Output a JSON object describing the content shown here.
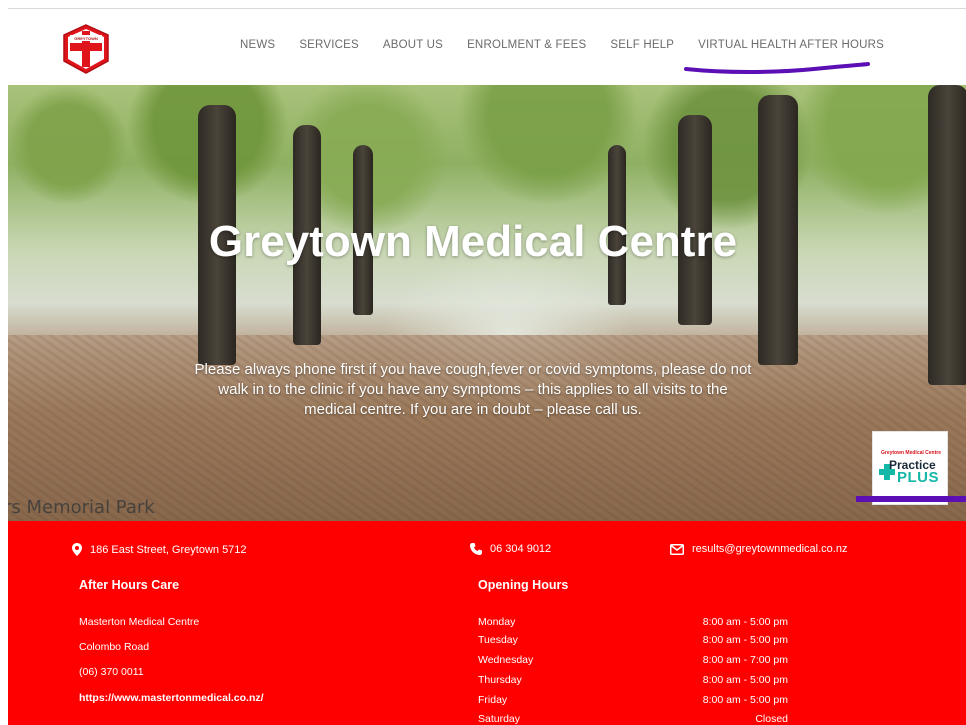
{
  "nav": {
    "items": [
      "NEWS",
      "SERVICES",
      "ABOUT US",
      "ENROLMENT & FEES",
      "SELF HELP",
      "VIRTUAL HEALTH AFTER HOURS"
    ]
  },
  "logo": {
    "text": "GREYTOWN MEDICAL"
  },
  "hero": {
    "title": "Greytown Medical Centre",
    "message": "Please always phone first if you have cough,fever or covid symptoms, please do not walk in to the clinic if you have any symptoms – this applies to all visits to the medical centre. If you are in doubt – please call us.",
    "park_label": "rs Memorial Park",
    "badge_top": "Greytown Medical Centre",
    "badge_practice": "Practice",
    "badge_plus": "PLUS"
  },
  "contact": {
    "address": "186 East Street, Greytown 5712",
    "phone": "06 304 9012",
    "email": "results@greytownmedical.co.nz"
  },
  "after_hours": {
    "title": "After Hours Care",
    "name": "Masterton Medical Centre",
    "street": "Colombo Road",
    "phone": "(06) 370 0011",
    "url": "https://www.mastertonmedical.co.nz/"
  },
  "opening_hours": {
    "title": "Opening Hours",
    "rows": [
      {
        "day": "Monday",
        "time": "8:00 am - 5:00 pm"
      },
      {
        "day": "Tuesday",
        "time": "8:00 am - 5:00 pm"
      },
      {
        "day": "Wednesday",
        "time": "8:00 am - 7:00 pm"
      },
      {
        "day": "Thursday",
        "time": "8:00 am - 5:00 pm"
      },
      {
        "day": "Friday",
        "time": "8:00 am - 5:00 pm"
      },
      {
        "day": "Saturday",
        "time": "Closed"
      }
    ]
  },
  "colors": {
    "red": "#ff0000",
    "nav_text": "#6b6b6b",
    "annotation_purple": "#5b0fb5"
  }
}
